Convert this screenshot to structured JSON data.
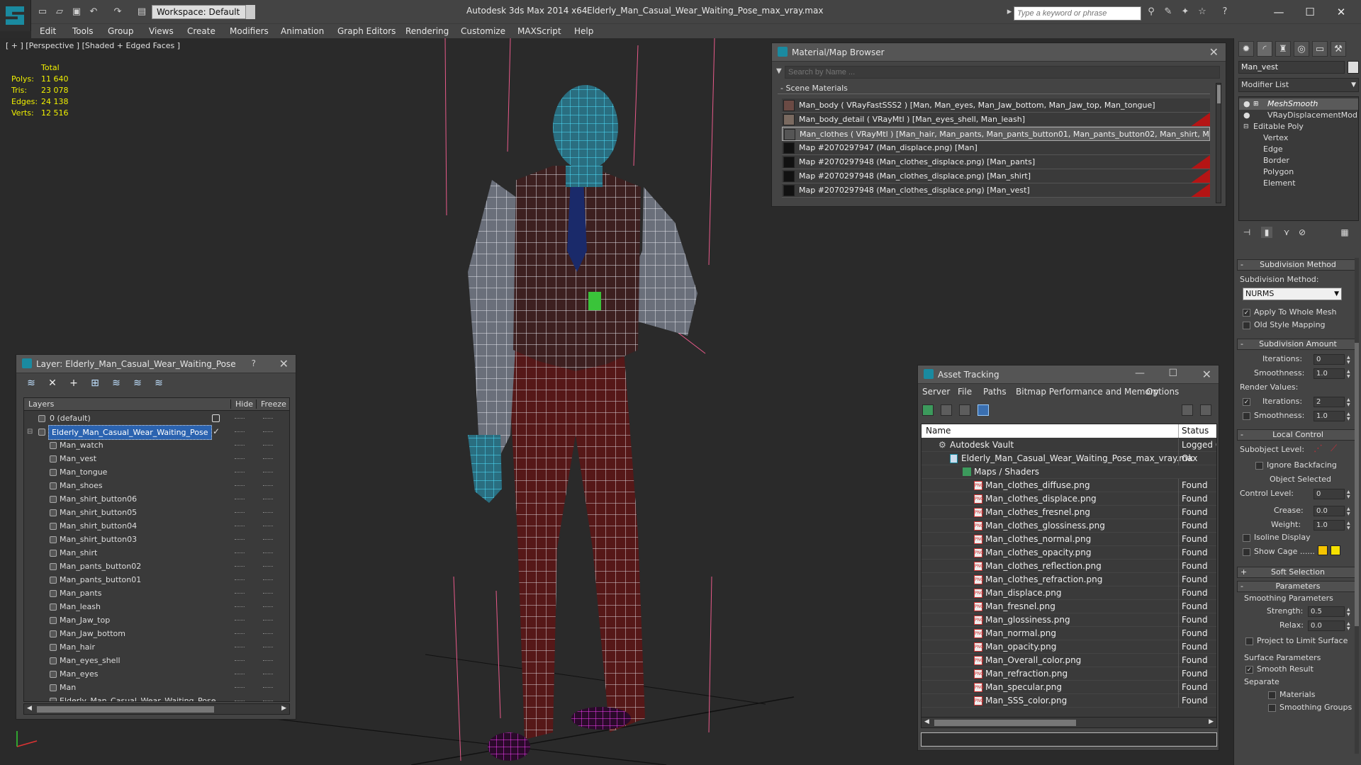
{
  "window": {
    "app_title": "Autodesk 3ds Max  2014 x64",
    "file_name": "Elderly_Man_Casual_Wear_Waiting_Pose_max_vray.max",
    "workspace_label": "Workspace: Default",
    "search_placeholder": "Type a keyword or phrase"
  },
  "menu": [
    "Edit",
    "Tools",
    "Group",
    "Views",
    "Create",
    "Modifiers",
    "Animation",
    "Graph Editors",
    "Rendering",
    "Customize",
    "MAXScript",
    "Help"
  ],
  "viewport": {
    "label": "[ + ] [Perspective ] [Shaded + Edged Faces ]",
    "stats_header": "Total",
    "stats": [
      {
        "key": "Polys:",
        "value": "11 640"
      },
      {
        "key": "Tris:",
        "value": "23 078"
      },
      {
        "key": "Edges:",
        "value": "24 138"
      },
      {
        "key": "Verts:",
        "value": "12 516"
      }
    ]
  },
  "material_browser": {
    "title": "Material/Map Browser",
    "search_placeholder": "Search by Name ...",
    "section": "- Scene Materials",
    "rows": [
      "Man_body  ( VRayFastSSS2 ) [Man, Man_eyes, Man_Jaw_bottom, Man_Jaw_top, Man_tongue]",
      "Man_body_detail  ( VRayMtl ) [Man_eyes_shell, Man_leash]",
      "Man_clothes  ( VRayMtl ) [Man_hair, Man_pants, Man_pants_button01, Man_pants_button02, Man_shirt, Man_s...",
      "Map #2070297947 (Man_displace.png) [Man]",
      "Map #2070297948 (Man_clothes_displace.png) [Man_pants]",
      "Map #2070297948 (Man_clothes_displace.png) [Man_shirt]",
      "Map #2070297948 (Man_clothes_displace.png) [Man_vest]"
    ]
  },
  "layer_panel": {
    "title": "Layer: Elderly_Man_Casual_Wear_Waiting_Pose",
    "help": "?",
    "col_layers": "Layers",
    "col_hide": "Hide",
    "col_freeze": "Freeze",
    "default_layer": "0 (default)",
    "active_layer": "Elderly_Man_Casual_Wear_Waiting_Pose",
    "objects": [
      "Man_watch",
      "Man_vest",
      "Man_tongue",
      "Man_shoes",
      "Man_shirt_button06",
      "Man_shirt_button05",
      "Man_shirt_button04",
      "Man_shirt_button03",
      "Man_shirt",
      "Man_pants_button02",
      "Man_pants_button01",
      "Man_pants",
      "Man_leash",
      "Man_Jaw_top",
      "Man_Jaw_bottom",
      "Man_hair",
      "Man_eyes_shell",
      "Man_eyes",
      "Man",
      "Elderly_Man_Casual_Wear_Waiting_Pose"
    ]
  },
  "asset_tracking": {
    "title": "Asset Tracking",
    "menu": [
      "Server",
      "File",
      "Paths",
      "Bitmap Performance and Memory",
      "Options"
    ],
    "col_name": "Name",
    "col_status": "Status",
    "vault": {
      "name": "Autodesk Vault",
      "status": "Logged O"
    },
    "file": {
      "name": "Elderly_Man_Casual_Wear_Waiting_Pose_max_vray.max",
      "status": "Ok"
    },
    "group": "Maps / Shaders",
    "maps": [
      {
        "name": "Man_clothes_diffuse.png",
        "status": "Found"
      },
      {
        "name": "Man_clothes_displace.png",
        "status": "Found"
      },
      {
        "name": "Man_clothes_fresnel.png",
        "status": "Found"
      },
      {
        "name": "Man_clothes_glossiness.png",
        "status": "Found"
      },
      {
        "name": "Man_clothes_normal.png",
        "status": "Found"
      },
      {
        "name": "Man_clothes_opacity.png",
        "status": "Found"
      },
      {
        "name": "Man_clothes_reflection.png",
        "status": "Found"
      },
      {
        "name": "Man_clothes_refraction.png",
        "status": "Found"
      },
      {
        "name": "Man_displace.png",
        "status": "Found"
      },
      {
        "name": "Man_fresnel.png",
        "status": "Found"
      },
      {
        "name": "Man_glossiness.png",
        "status": "Found"
      },
      {
        "name": "Man_normal.png",
        "status": "Found"
      },
      {
        "name": "Man_opacity.png",
        "status": "Found"
      },
      {
        "name": "Man_Overall_color.png",
        "status": "Found"
      },
      {
        "name": "Man_refraction.png",
        "status": "Found"
      },
      {
        "name": "Man_specular.png",
        "status": "Found"
      },
      {
        "name": "Man_SSS_color.png",
        "status": "Found"
      }
    ]
  },
  "command_panel": {
    "object_name": "Man_vest",
    "modifier_list": "Modifier List",
    "stack": [
      "MeshSmooth",
      "VRayDisplacementMod",
      "Editable Poly",
      "Vertex",
      "Edge",
      "Border",
      "Polygon",
      "Element"
    ],
    "subdiv_method_title": "Subdivision Method",
    "subdiv_method_label": "Subdivision Method:",
    "subdiv_method_value": "NURMS",
    "apply_whole_mesh": "Apply To Whole Mesh",
    "old_style_mapping": "Old Style Mapping",
    "subdiv_amount_title": "Subdivision Amount",
    "iterations_label": "Iterations:",
    "iterations_value": "0",
    "smoothness_label": "Smoothness:",
    "smoothness_value": "1.0",
    "render_values_label": "Render Values:",
    "render_iterations_label": "Iterations:",
    "render_iterations_value": "2",
    "render_smoothness_label": "Smoothness:",
    "render_smoothness_value": "1.0",
    "local_control_title": "Local Control",
    "subobject_level_label": "Subobject Level:",
    "ignore_backfacing": "Ignore Backfacing",
    "object_selected": "Object Selected",
    "control_level_label": "Control Level:",
    "control_level_value": "0",
    "crease_label": "Crease:",
    "crease_value": "0.0",
    "weight_label": "Weight:",
    "weight_value": "1.0",
    "isoline_display": "Isoline Display",
    "show_cage": "Show Cage ......",
    "soft_selection_title": "Soft Selection",
    "parameters_title": "Parameters",
    "smoothing_params_label": "Smoothing Parameters",
    "strength_label": "Strength:",
    "strength_value": "0.5",
    "relax_label": "Relax:",
    "relax_value": "0.0",
    "project_limit": "Project to Limit Surface",
    "surface_params_label": "Surface Parameters",
    "smooth_result": "Smooth Result",
    "separate_label": "Separate",
    "materials": "Materials",
    "smoothing_groups": "Smoothing Groups",
    "cage_color_1": "#f5c400",
    "cage_color_2": "#f5e000"
  }
}
